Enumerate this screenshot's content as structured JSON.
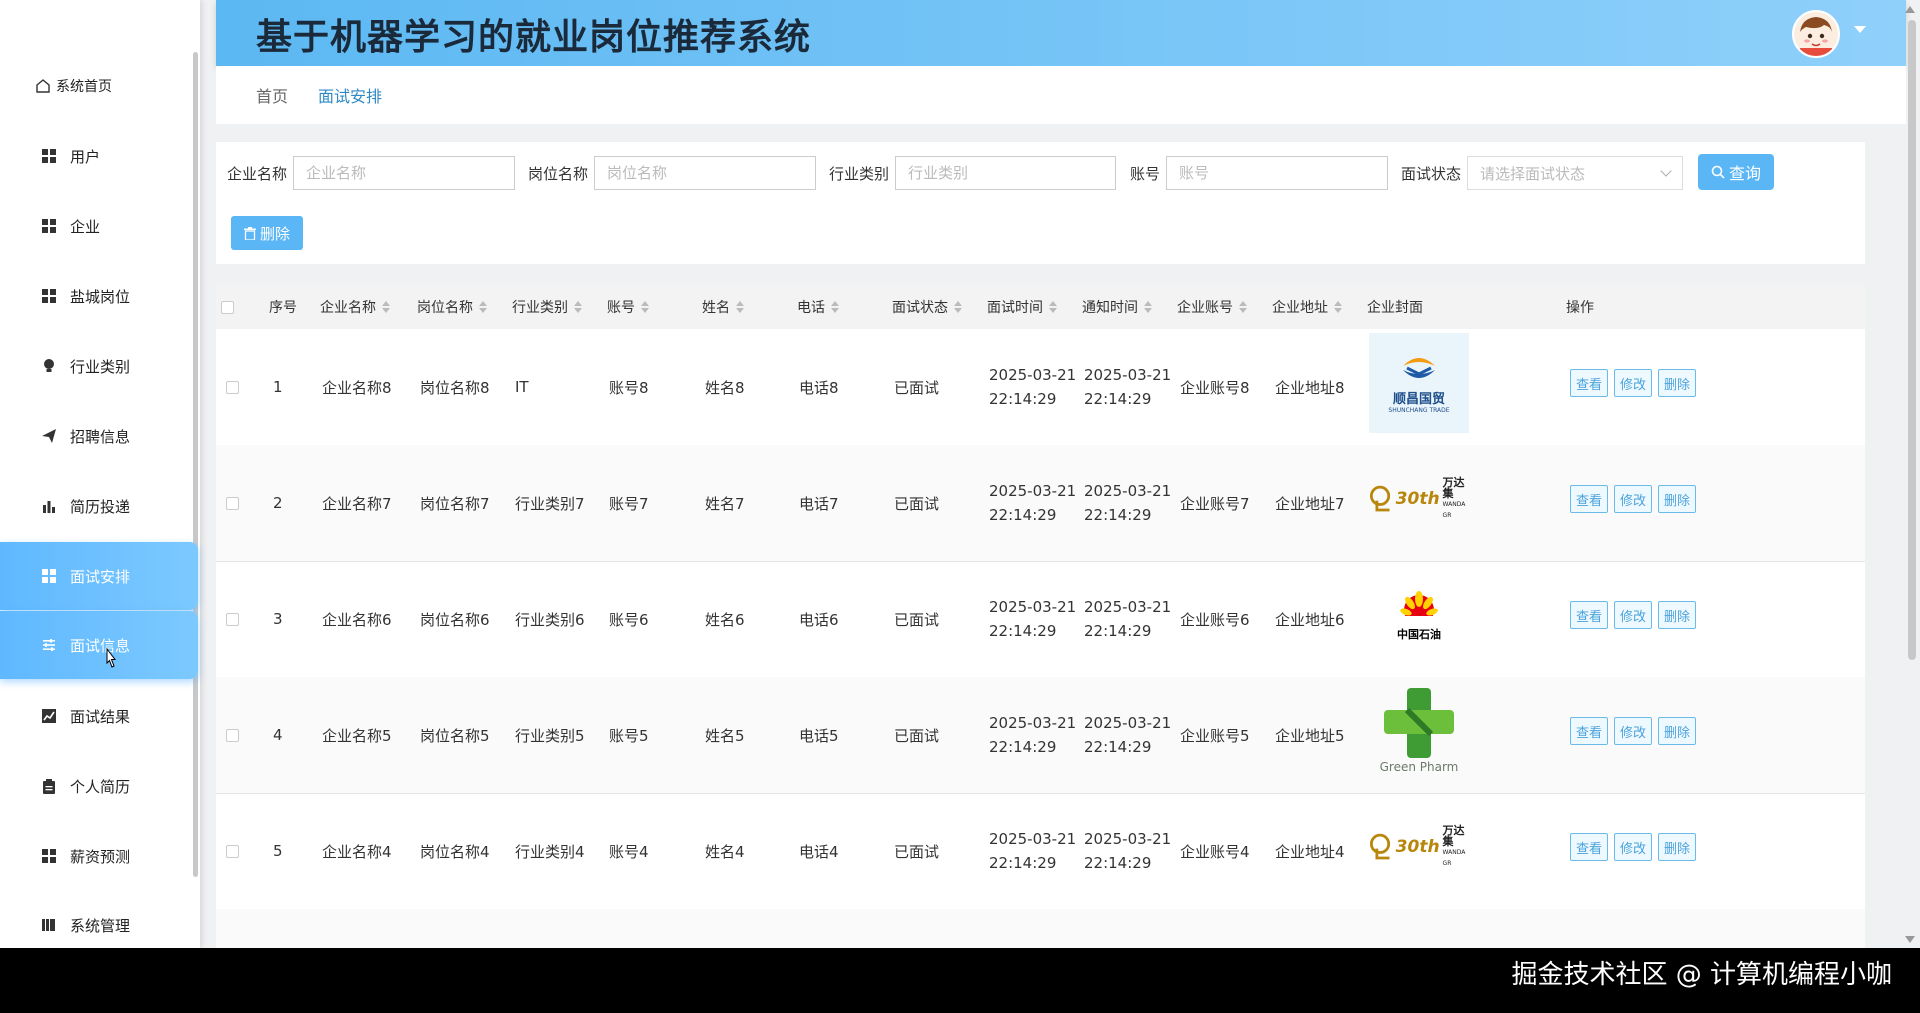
{
  "header": {
    "title": "基于机器学习的就业岗位推荐系统"
  },
  "sidebar": {
    "items": [
      {
        "label": "系统首页",
        "icon": "home-icon"
      },
      {
        "label": "用户",
        "icon": "grid-icon"
      },
      {
        "label": "企业",
        "icon": "grid-icon"
      },
      {
        "label": "盐城岗位",
        "icon": "grid-icon"
      },
      {
        "label": "行业类别",
        "icon": "bulb-icon"
      },
      {
        "label": "招聘信息",
        "icon": "send-icon"
      },
      {
        "label": "简历投递",
        "icon": "bar-chart-icon"
      },
      {
        "label": "面试安排",
        "icon": "grid-icon",
        "active": true
      },
      {
        "label": "面试信息",
        "icon": "sliders-icon",
        "active": true
      },
      {
        "label": "面试结果",
        "icon": "line-chart-icon"
      },
      {
        "label": "个人简历",
        "icon": "clipboard-icon"
      },
      {
        "label": "薪资预测",
        "icon": "grid-icon"
      },
      {
        "label": "系统管理",
        "icon": "book-icon"
      }
    ]
  },
  "breadcrumb": {
    "home": "首页",
    "current": "面试安排"
  },
  "search": {
    "company_label": "企业名称",
    "company_placeholder": "企业名称",
    "job_label": "岗位名称",
    "job_placeholder": "岗位名称",
    "industry_label": "行业类别",
    "industry_placeholder": "行业类别",
    "account_label": "账号",
    "account_placeholder": "账号",
    "status_label": "面试状态",
    "status_placeholder": "请选择面试状态",
    "query_button": "查询",
    "delete_button": "删除"
  },
  "table": {
    "headers": [
      "序号",
      "企业名称",
      "岗位名称",
      "行业类别",
      "账号",
      "姓名",
      "电话",
      "面试状态",
      "面试时间",
      "通知时间",
      "企业账号",
      "企业地址",
      "企业封面",
      "操作"
    ],
    "ops": {
      "view": "查看",
      "edit": "修改",
      "delete": "删除"
    },
    "rows": [
      {
        "no": "1",
        "company": "企业名称8",
        "job": "岗位名称8",
        "industry": "IT",
        "account": "账号8",
        "name": "姓名8",
        "phone": "电话8",
        "status": "已面试",
        "interview_date": "2025-03-21",
        "interview_time": "22:14:29",
        "notify_date": "2025-03-21",
        "notify_time": "22:14:29",
        "company_account": "企业账号8",
        "address": "企业地址8",
        "logo": "shunchang-logo",
        "logo_text": "顺昌国贸",
        "logo_sub": "SHUNCHANG TRADE"
      },
      {
        "no": "2",
        "company": "企业名称7",
        "job": "岗位名称7",
        "industry": "行业类别7",
        "account": "账号7",
        "name": "姓名7",
        "phone": "电话7",
        "status": "已面试",
        "interview_date": "2025-03-21",
        "interview_time": "22:14:29",
        "notify_date": "2025-03-21",
        "notify_time": "22:14:29",
        "company_account": "企业账号7",
        "address": "企业地址7",
        "logo": "wanda-logo",
        "logo_text": "万达集",
        "logo_sub": "WANDA GR",
        "logo_num": "30th"
      },
      {
        "no": "3",
        "company": "企业名称6",
        "job": "岗位名称6",
        "industry": "行业类别6",
        "account": "账号6",
        "name": "姓名6",
        "phone": "电话6",
        "status": "已面试",
        "interview_date": "2025-03-21",
        "interview_time": "22:14:29",
        "notify_date": "2025-03-21",
        "notify_time": "22:14:29",
        "company_account": "企业账号6",
        "address": "企业地址6",
        "logo": "petrochina-logo",
        "logo_text": "中国石油"
      },
      {
        "no": "4",
        "company": "企业名称5",
        "job": "岗位名称5",
        "industry": "行业类别5",
        "account": "账号5",
        "name": "姓名5",
        "phone": "电话5",
        "status": "已面试",
        "interview_date": "2025-03-21",
        "interview_time": "22:14:29",
        "notify_date": "2025-03-21",
        "notify_time": "22:14:29",
        "company_account": "企业账号5",
        "address": "企业地址5",
        "logo": "greenpharm-logo",
        "logo_text": "Green Pharm"
      },
      {
        "no": "5",
        "company": "企业名称4",
        "job": "岗位名称4",
        "industry": "行业类别4",
        "account": "账号4",
        "name": "姓名4",
        "phone": "电话4",
        "status": "已面试",
        "interview_date": "2025-03-21",
        "interview_time": "22:14:29",
        "notify_date": "2025-03-21",
        "notify_time": "22:14:29",
        "company_account": "企业账号4",
        "address": "企业地址4",
        "logo": "wanda-logo",
        "logo_text": "万达集",
        "logo_sub": "WANDA GR",
        "logo_num": "30th"
      }
    ]
  },
  "watermark": "掘金技术社区 @ 计算机编程小咖",
  "colors": {
    "accent": "#5ab6f5",
    "header_start": "#5cb8f2",
    "header_end": "#8fd0fb",
    "active_menu": "#6cc0ff"
  }
}
